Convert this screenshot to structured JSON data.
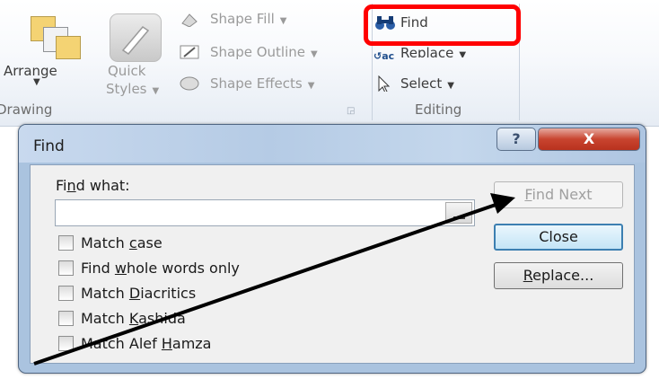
{
  "ribbon": {
    "arrange_label": "Arrange",
    "quick_styles_line1": "Quick",
    "quick_styles_line2": "Styles",
    "shape_fill": "Shape Fill",
    "shape_outline": "Shape Outline",
    "shape_effects": "Shape Effects",
    "find": "Find",
    "replace": "Replace",
    "select": "Select",
    "group_drawing": "Drawing",
    "group_editing": "Editing"
  },
  "dialog": {
    "title": "Find",
    "help_glyph": "?",
    "close_glyph": "X",
    "find_what_prefix": "Fi",
    "find_what_ul": "n",
    "find_what_suffix": "d what:",
    "find_what_value": "",
    "options": [
      {
        "pre": "Match ",
        "ul": "c",
        "post": "ase",
        "checked": false
      },
      {
        "pre": "Find ",
        "ul": "w",
        "post": "hole words only",
        "checked": false
      },
      {
        "pre": "Match ",
        "ul": "D",
        "post": "iacritics",
        "checked": false
      },
      {
        "pre": "Match ",
        "ul": "K",
        "post": "ashida",
        "checked": false
      },
      {
        "pre": "Match Alef ",
        "ul": "H",
        "post": "amza",
        "checked": false
      }
    ],
    "buttons": {
      "find_next_ul": "F",
      "find_next_rest": "ind Next",
      "close": "Close",
      "replace_ul": "R",
      "replace_rest": "eplace..."
    }
  },
  "colors": {
    "highlight": "#ff0000",
    "arrow": "#000000",
    "close_button": "#c8442f"
  }
}
